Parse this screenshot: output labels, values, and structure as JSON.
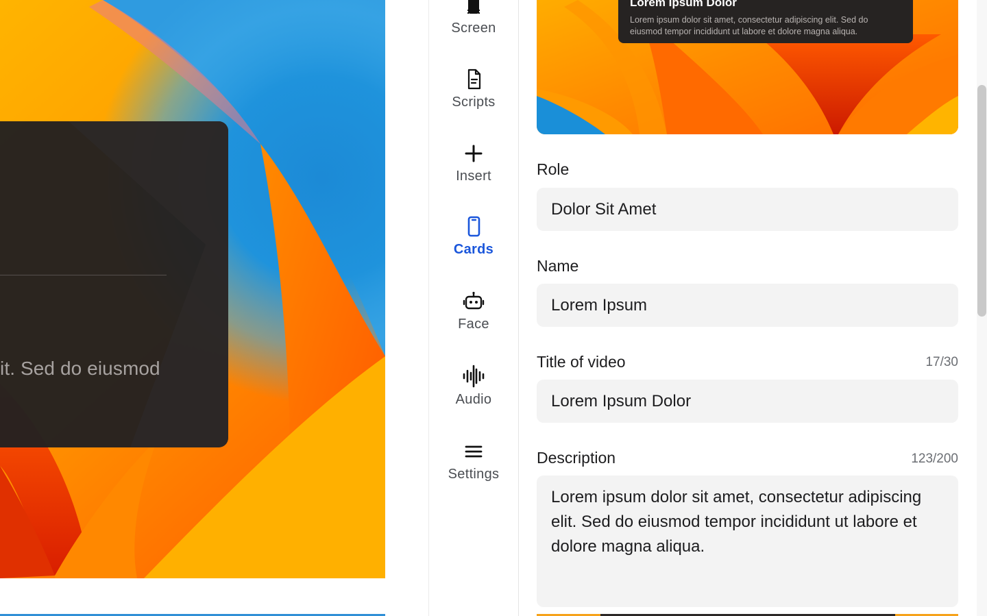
{
  "preview": {
    "overlay_text": "it. Sed do eiusmod"
  },
  "rail": {
    "items": [
      {
        "label": "Screen",
        "icon": "screen-icon"
      },
      {
        "label": "Scripts",
        "icon": "document-icon"
      },
      {
        "label": "Insert",
        "icon": "plus-icon"
      },
      {
        "label": "Cards",
        "icon": "phone-card-icon",
        "active": true
      },
      {
        "label": "Face",
        "icon": "robot-face-icon"
      },
      {
        "label": "Audio",
        "icon": "waveform-icon"
      },
      {
        "label": "Settings",
        "icon": "menu-lines-icon"
      }
    ]
  },
  "card_preview": {
    "title": "Lorem Ipsum Dolor",
    "body": "Lorem ipsum dolor sit amet, consectetur adipiscing elit. Sed do eiusmod tempor incididunt ut labore et dolore magna aliqua."
  },
  "form": {
    "role": {
      "label": "Role",
      "value": "Dolor Sit Amet"
    },
    "name": {
      "label": "Name",
      "value": "Lorem Ipsum"
    },
    "title": {
      "label": "Title of video",
      "counter": "17/30",
      "value": "Lorem Ipsum Dolor"
    },
    "description": {
      "label": "Description",
      "counter": "123/200",
      "value": "Lorem ipsum dolor sit amet, consectetur adipiscing elit. Sed do eiusmod tempor incididunt ut labore et dolore magna aliqua."
    }
  },
  "colors": {
    "accent": "#1a56db",
    "overlay": "#262322",
    "field_bg": "#f3f3f3",
    "wallpaper_orange": "#ff7a00",
    "wallpaper_blue": "#1a8fd8"
  }
}
